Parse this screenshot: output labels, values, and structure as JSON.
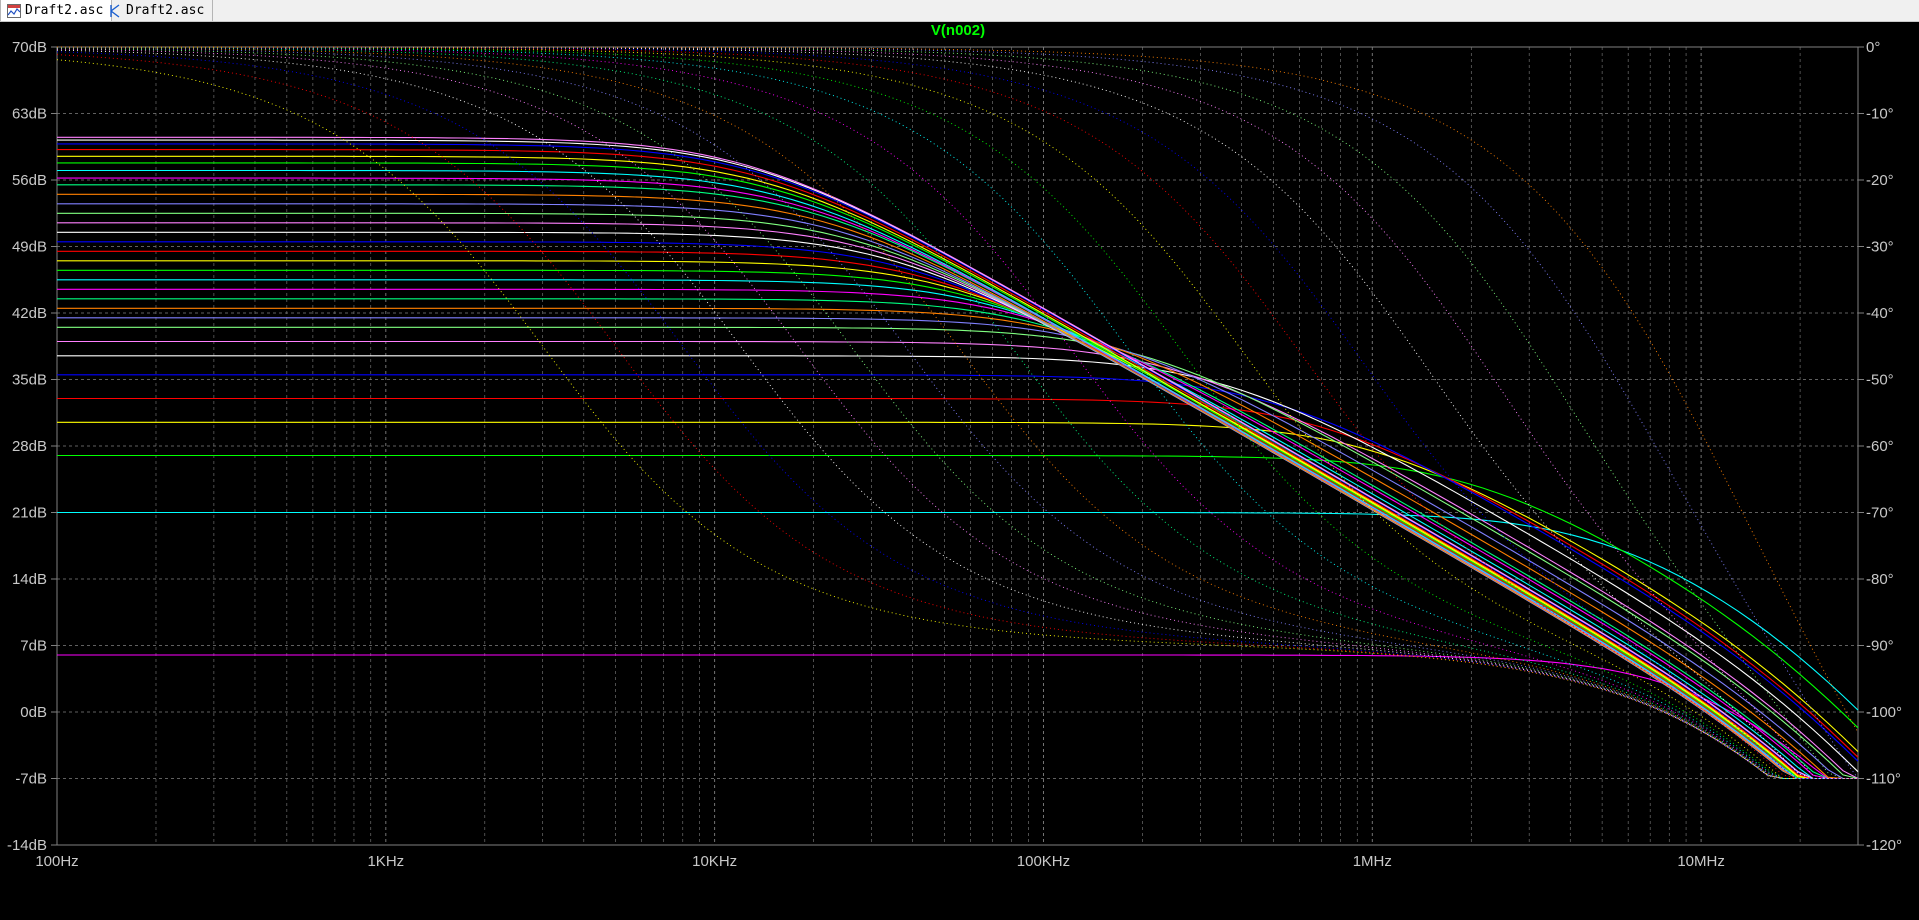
{
  "tabs": [
    {
      "label": "Draft2.asc",
      "icon": "waveform-icon",
      "active": true
    },
    {
      "label": "Draft2.asc",
      "icon": "schematic-icon",
      "active": false
    }
  ],
  "colors": {
    "background": "#000000",
    "grid": "#808080",
    "axis_text": "#c8c8c8",
    "trace_title": "#00ff00"
  },
  "chart_data": {
    "type": "line",
    "title": "V(n002)",
    "x_scale": "log",
    "xlim": [
      100,
      30000000
    ],
    "x_ticks": [
      {
        "value": 100,
        "label": "100Hz"
      },
      {
        "value": 1000,
        "label": "1KHz"
      },
      {
        "value": 10000,
        "label": "10KHz"
      },
      {
        "value": 100000,
        "label": "100KHz"
      },
      {
        "value": 1000000,
        "label": "1MHz"
      },
      {
        "value": 10000000,
        "label": "10MHz"
      }
    ],
    "ylim": [
      -14,
      70
    ],
    "y_ticks": [
      {
        "value": 70,
        "label": "70dB"
      },
      {
        "value": 63,
        "label": "63dB"
      },
      {
        "value": 56,
        "label": "56dB"
      },
      {
        "value": 49,
        "label": "49dB"
      },
      {
        "value": 42,
        "label": "42dB"
      },
      {
        "value": 35,
        "label": "35dB"
      },
      {
        "value": 28,
        "label": "28dB"
      },
      {
        "value": 21,
        "label": "21dB"
      },
      {
        "value": 14,
        "label": "14dB"
      },
      {
        "value": 7,
        "label": "7dB"
      },
      {
        "value": 0,
        "label": "0dB"
      },
      {
        "value": -7,
        "label": "-7dB"
      },
      {
        "value": -14,
        "label": "-14dB"
      }
    ],
    "y2lim": [
      -120,
      0
    ],
    "y2_ticks": [
      {
        "value": 0,
        "label": "0°"
      },
      {
        "value": -10,
        "label": "-10°"
      },
      {
        "value": -20,
        "label": "-20°"
      },
      {
        "value": -30,
        "label": "-30°"
      },
      {
        "value": -40,
        "label": "-40°"
      },
      {
        "value": -50,
        "label": "-50°"
      },
      {
        "value": -60,
        "label": "-60°"
      },
      {
        "value": -70,
        "label": "-70°"
      },
      {
        "value": -80,
        "label": "-80°"
      },
      {
        "value": -90,
        "label": "-90°"
      },
      {
        "value": -100,
        "label": "-100°"
      },
      {
        "value": -110,
        "label": "-110°"
      },
      {
        "value": -120,
        "label": "-120°"
      }
    ],
    "grid": true,
    "magnitude_sweep": {
      "dc_gain_db": [
        6,
        21,
        27,
        30.5,
        33,
        35.5,
        37.5,
        39,
        40.5,
        41.5,
        42.5,
        43.5,
        44.5,
        45.5,
        46.5,
        47.5,
        48.5,
        49.5,
        50.5,
        51.5,
        52.5,
        53.5,
        54.5,
        55.5,
        56.2,
        57,
        57.8,
        58.5,
        59.2,
        59.8,
        60.2,
        60.5
      ],
      "pole_hz": [
        9000000,
        5000000,
        2000000,
        1000000,
        700000,
        500000,
        350000,
        250000,
        200000,
        160000,
        130000,
        105000,
        90000,
        75000,
        63000,
        54000,
        46000,
        40000,
        35000,
        31000,
        27500,
        24500,
        22000,
        20000,
        18500,
        17000,
        16000,
        15000,
        14200,
        13600,
        13100,
        12700
      ],
      "second_pole_hz": 20000000,
      "high_freq_floor_db": -7
    },
    "phase_sweep": {
      "phase_end_deg": -110,
      "dominant_pole_hz": [
        3000,
        5000,
        8000,
        12000,
        18000,
        26000,
        38000,
        55000,
        80000,
        120000,
        180000,
        260000,
        400000,
        600000,
        900000,
        1400000,
        2200000,
        3500000,
        6000000,
        10000000
      ]
    },
    "series_colors": [
      "#ff00ff",
      "#00ffff",
      "#00ff00",
      "#ffff00",
      "#ff0000",
      "#0000ff",
      "#ffffff",
      "#ff80ff",
      "#80ff80",
      "#8080ff",
      "#ff8000",
      "#00ff80"
    ]
  }
}
